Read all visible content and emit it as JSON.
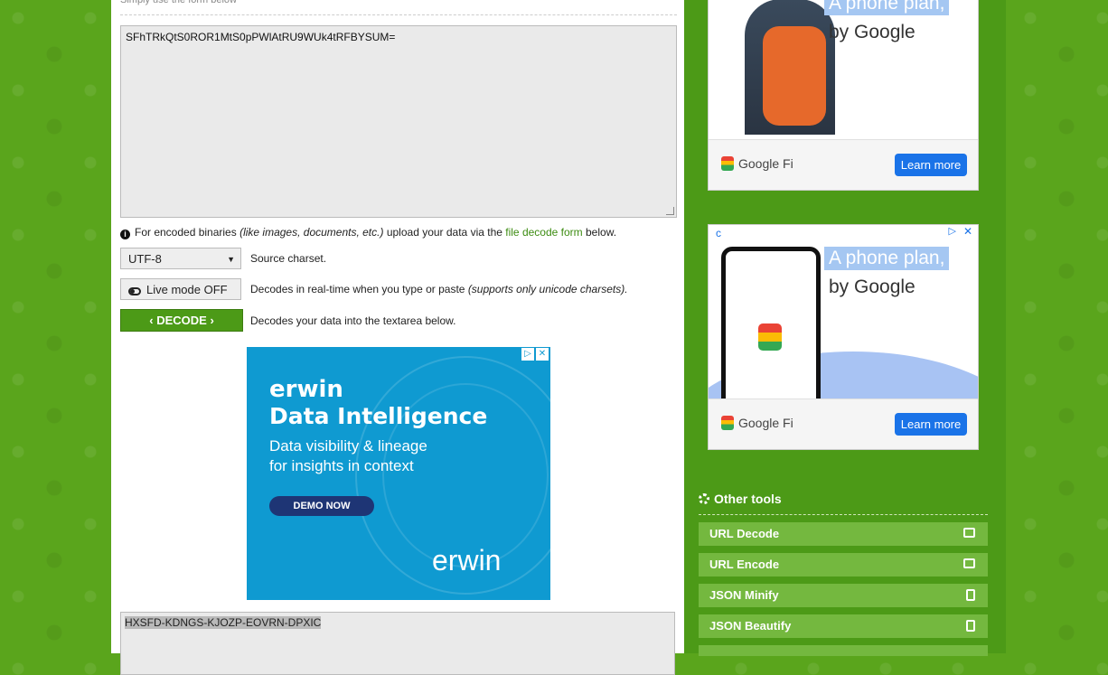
{
  "form": {
    "hint": "Simply use the form below",
    "input_value": "SFhTRkQtS0ROR1MtS0pPWlAtRU9WUk4tRFBYSUM=",
    "info_prefix": "For encoded binaries",
    "info_italic": "(like images, documents, etc.)",
    "info_mid": "upload your data via the",
    "info_link": "file decode form",
    "info_suffix": "below.",
    "charset_value": "UTF-8",
    "charset_label": "Source charset.",
    "live_mode_label": "Live mode OFF",
    "live_desc_prefix": "Decodes in real-time when you type or paste",
    "live_desc_italic": "(supports only unicode charsets).",
    "decode_label": "DECODE",
    "decode_desc": "Decodes your data into the textarea below.",
    "output_value": "HXSFD-KDNGS-KJOZP-EOVRN-DPXIC"
  },
  "ad_center": {
    "brand": "erwin",
    "headline": "Data Intelligence",
    "line1": "Data visibility & lineage",
    "line2": "for insights in context",
    "cta": "DEMO NOW",
    "logo": "erwin"
  },
  "ad_side": [
    {
      "headline1": "A phone plan,",
      "headline2": "by Google",
      "brand": "Google Fi",
      "cta": "Learn more"
    },
    {
      "headline1": "A phone plan,",
      "headline2": "by Google",
      "brand": "Google Fi",
      "cta": "Learn more"
    }
  ],
  "other_tools": {
    "title": "Other tools",
    "items": [
      {
        "label": "URL Decode",
        "icon": "envelope-open-icon"
      },
      {
        "label": "URL Encode",
        "icon": "envelope-icon"
      },
      {
        "label": "JSON Minify",
        "icon": "file-icon"
      },
      {
        "label": "JSON Beautify",
        "icon": "file-code-icon"
      }
    ]
  },
  "colors": {
    "accent": "#4c9a17",
    "tool_bg": "#74b83f",
    "ad_blue": "#0f9ad1"
  }
}
